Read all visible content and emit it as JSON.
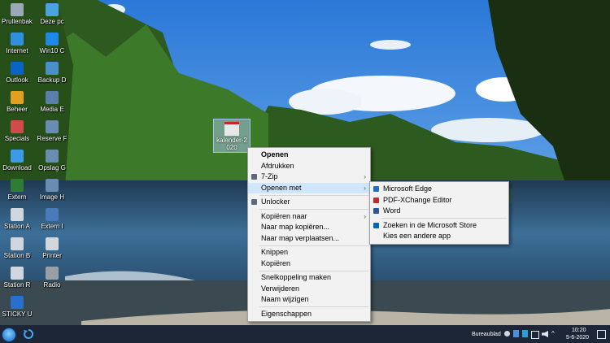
{
  "desktop_icons": [
    {
      "label": "Prullenbak",
      "icon": "recycle-bin-icon",
      "color": "#9aa8b8"
    },
    {
      "label": "Deze pc",
      "icon": "this-pc-icon",
      "color": "#4aa3df"
    },
    {
      "label": "Internet",
      "icon": "internet-explorer-icon",
      "color": "#2f8fe0"
    },
    {
      "label": "Win10 C",
      "icon": "win10-icon",
      "color": "#1e88e5"
    },
    {
      "label": "Outlook",
      "icon": "outlook-icon",
      "color": "#0a64c8"
    },
    {
      "label": "Backup D",
      "icon": "backup-icon",
      "color": "#4a90c8"
    },
    {
      "label": "Beheer",
      "icon": "admin-tools-icon",
      "color": "#e0a020"
    },
    {
      "label": "Media E",
      "icon": "media-icon",
      "color": "#5a7fa8"
    },
    {
      "label": "Specials",
      "icon": "specials-icon",
      "color": "#d24b4b"
    },
    {
      "label": "Reserve F",
      "icon": "reserve-drive-icon",
      "color": "#6a8cb0"
    },
    {
      "label": "Download",
      "icon": "download-icon",
      "color": "#3c9be8"
    },
    {
      "label": "Opslag G",
      "icon": "storage-drive-icon",
      "color": "#6a8cb0"
    },
    {
      "label": "Extern",
      "icon": "external-icon",
      "color": "#2e7d32"
    },
    {
      "label": "Image H",
      "icon": "image-drive-icon",
      "color": "#6a8cb0"
    },
    {
      "label": "Station A",
      "icon": "drive-a-icon",
      "color": "#cfd6de"
    },
    {
      "label": "Extern I",
      "icon": "external-drive-icon",
      "color": "#4a78b8"
    },
    {
      "label": "Station B",
      "icon": "drive-b-icon",
      "color": "#cfd6de"
    },
    {
      "label": "Printer",
      "icon": "printer-icon",
      "color": "#cfd6de"
    },
    {
      "label": "Station R",
      "icon": "drive-r-icon",
      "color": "#cfd6de"
    },
    {
      "label": "Radio",
      "icon": "radio-icon",
      "color": "#9aa0a6"
    },
    {
      "label": "STICKY U",
      "icon": "usb-eject-icon",
      "color": "#2a6fd0"
    }
  ],
  "file": {
    "label_line1": "kalender-2",
    "label_line2": "020"
  },
  "context_menu": {
    "items": [
      {
        "label": "Openen",
        "bold": true
      },
      {
        "label": "Afdrukken"
      },
      {
        "label": "7-Zip",
        "submenu": true,
        "icon": "7zip-icon"
      },
      {
        "label": "Openen met",
        "submenu": true,
        "highlighted": true
      },
      {
        "sep": true
      },
      {
        "label": "Unlocker",
        "icon": "unlocker-icon"
      },
      {
        "sep": true
      },
      {
        "label": "Kopiëren naar",
        "submenu": true
      },
      {
        "label": "Naar map kopiëren..."
      },
      {
        "label": "Naar map verplaatsen..."
      },
      {
        "sep": true
      },
      {
        "label": "Knippen"
      },
      {
        "label": "Kopiëren"
      },
      {
        "sep": true
      },
      {
        "label": "Snelkoppeling maken"
      },
      {
        "label": "Verwijderen"
      },
      {
        "label": "Naam wijzigen"
      },
      {
        "sep": true
      },
      {
        "label": "Eigenschappen"
      }
    ],
    "arrow_glyph": "›"
  },
  "open_with_menu": {
    "items": [
      {
        "label": "Microsoft Edge",
        "icon": "edge-icon",
        "color": "#1f6fc5"
      },
      {
        "label": "PDF-XChange Editor",
        "icon": "pdf-xchange-icon",
        "color": "#c62828"
      },
      {
        "label": "Word",
        "icon": "word-icon",
        "color": "#2b579a"
      },
      {
        "sep": true
      },
      {
        "label": "Zoeken in de Microsoft Store",
        "icon": "store-icon",
        "color": "#0067b8"
      },
      {
        "label": "Kies een andere app"
      }
    ]
  },
  "taskbar": {
    "desktop_label": "Bureaublad",
    "time": "10:20",
    "date": "5-6-2020"
  }
}
